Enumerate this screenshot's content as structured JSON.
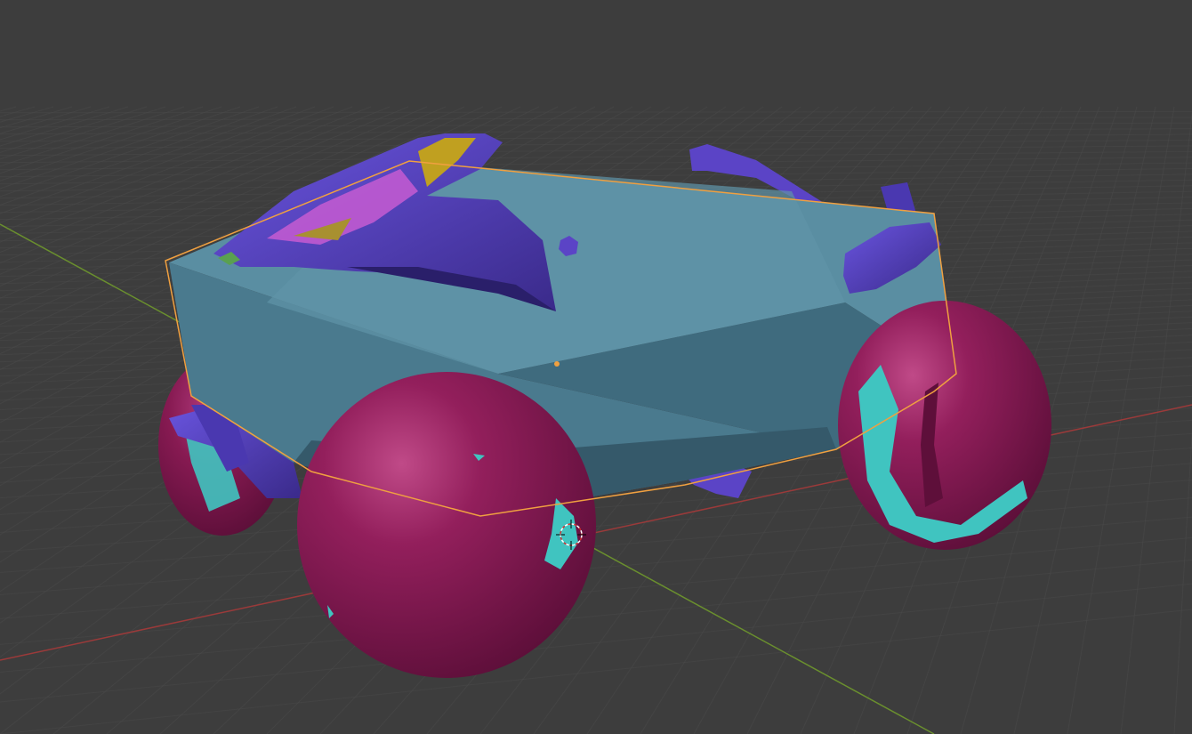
{
  "viewport": {
    "mode": "object-mode",
    "selected_object": "vehicle-body",
    "colors": {
      "background": "#3d3d3d",
      "grid": "#4a4a4a",
      "axis_x": "#9b3a3a",
      "axis_y": "#6a8f2e",
      "selection_outline": "#f0a040",
      "body": "#55869a",
      "body_dark": "#3e6a7c",
      "wheel": "#8e1d58",
      "wheel_dark": "#6b1344",
      "cyan_paint": "#40c4c0",
      "purple_parts": "#5b44c6",
      "purple_dark": "#3a2a8a",
      "pink_fin": "#c05ad0",
      "yellow_fin": "#c0a020",
      "green_spot": "#5aa050"
    }
  }
}
